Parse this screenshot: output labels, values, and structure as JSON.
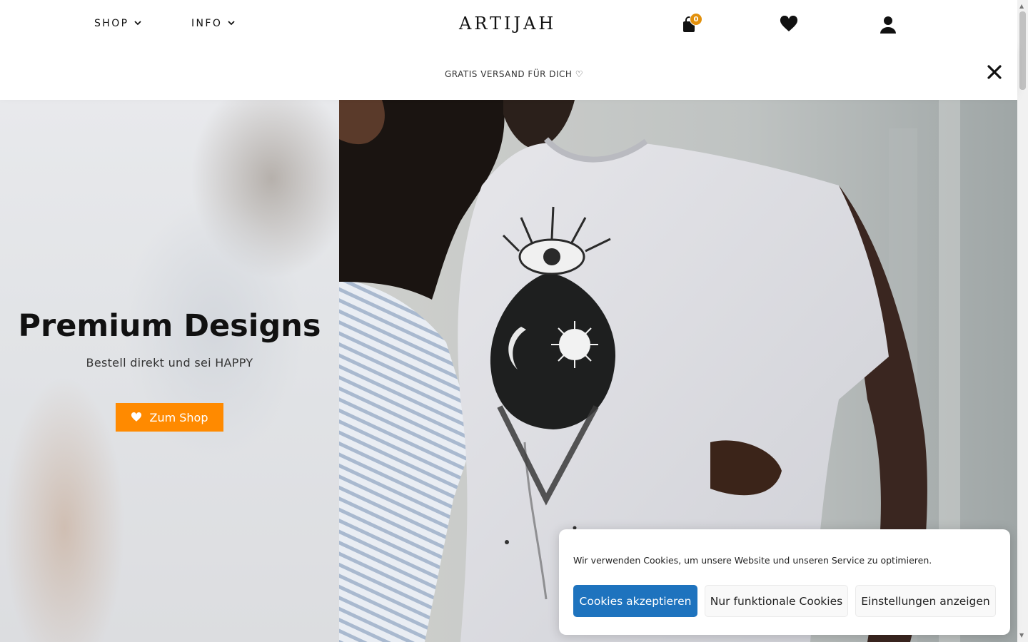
{
  "header": {
    "nav": [
      {
        "label": "SHOP"
      },
      {
        "label": "INFO"
      }
    ],
    "logo": "ARTIJAH",
    "cart_count": "0",
    "icons": [
      "cart-icon",
      "heart-icon",
      "user-icon"
    ]
  },
  "promo": {
    "text": "GRATIS VERSAND FÜR DICH ♡"
  },
  "hero": {
    "title": "Premium Designs",
    "subtitle": "Bestell direkt und sei HAPPY",
    "button_label": "Zum Shop",
    "button_color": "#ff8a00"
  },
  "cookie_banner": {
    "text": "Wir verwenden Cookies, um unsere Website und unseren Service zu optimieren.",
    "accept_label": "Cookies akzeptieren",
    "functional_label": "Nur funktionale Cookies",
    "settings_label": "Einstellungen anzeigen",
    "accept_color": "#1e73be"
  },
  "colors": {
    "badge": "#e2900b",
    "text": "#111111"
  }
}
